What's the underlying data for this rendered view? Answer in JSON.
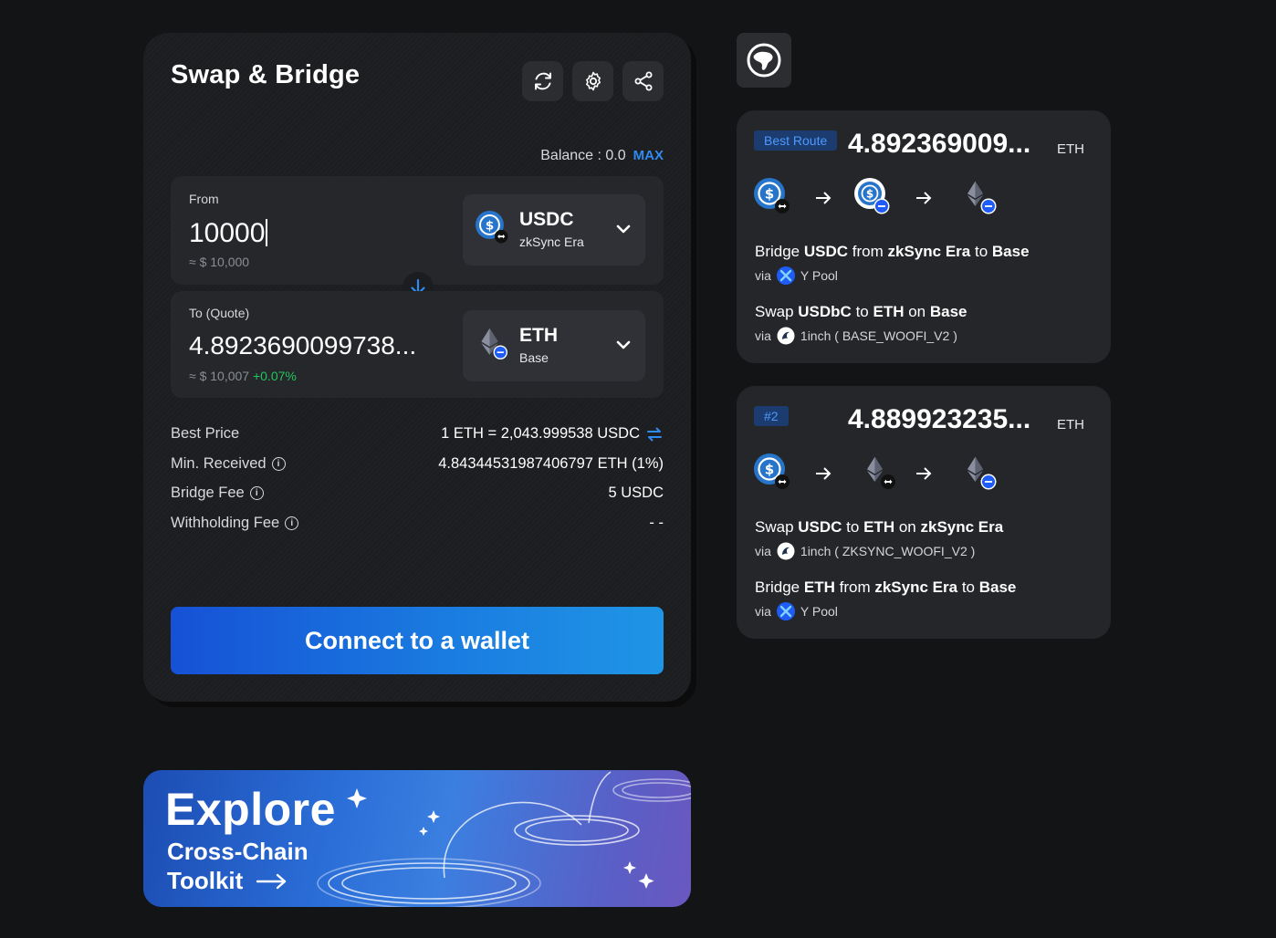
{
  "swap": {
    "title": "Swap & Bridge",
    "balance_label": "Balance : 0.0",
    "max_label": "MAX",
    "from": {
      "label": "From",
      "amount": "10000",
      "usd": "≈ $ 10,000",
      "token": "USDC",
      "chain": "zkSync Era"
    },
    "to": {
      "label": "To (Quote)",
      "amount": "4.8923690099738...",
      "usd": "≈ $ 10,007",
      "usd_change": "+0.07%",
      "token": "ETH",
      "chain": "Base"
    },
    "details": {
      "best_price_label": "Best Price",
      "best_price_value": "1 ETH = 2,043.999538 USDC",
      "min_received_label": "Min. Received",
      "min_received_value": "4.84344531987406797 ETH (1%)",
      "bridge_fee_label": "Bridge Fee",
      "bridge_fee_value": "5 USDC",
      "withholding_fee_label": "Withholding Fee",
      "withholding_fee_value": "- -"
    },
    "connect_label": "Connect to a wallet"
  },
  "banner": {
    "line1": "Explore",
    "line2": "Cross-Chain",
    "line3": "Toolkit"
  },
  "routes": [
    {
      "badge": "Best Route",
      "amount": "4.892369009...",
      "symbol": "ETH",
      "step1_action": "Bridge",
      "step1_token": "USDC",
      "step1_mid": "from",
      "step1_src": "zkSync Era",
      "step1_to": "to",
      "step1_dst": "Base",
      "step1_via": "via",
      "step1_provider": "Y Pool",
      "step2_action": "Swap",
      "step2_token": "USDbC",
      "step2_mid": "to",
      "step2_src": "ETH",
      "step2_to": "on",
      "step2_dst": "Base",
      "step2_via": "via",
      "step2_provider": "1inch ( BASE_WOOFI_V2 )"
    },
    {
      "badge": "#2",
      "amount": "4.889923235...",
      "symbol": "ETH",
      "step1_action": "Swap",
      "step1_token": "USDC",
      "step1_mid": "to",
      "step1_src": "ETH",
      "step1_to": "on",
      "step1_dst": "zkSync Era",
      "step1_via": "via",
      "step1_provider": "1inch ( ZKSYNC_WOOFI_V2 )",
      "step2_action": "Bridge",
      "step2_token": "ETH",
      "step2_mid": "from",
      "step2_src": "zkSync Era",
      "step2_to": "to",
      "step2_dst": "Base",
      "step2_via": "via",
      "step2_provider": "Y Pool"
    }
  ],
  "colors": {
    "accent": "#2f8bf0",
    "positive": "#22c55e",
    "badge_bg": "#1c3b6e"
  }
}
